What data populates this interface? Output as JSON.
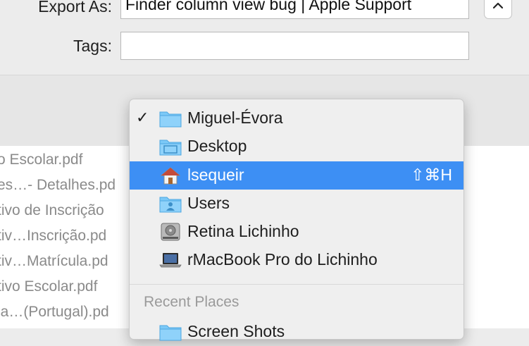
{
  "export": {
    "label": "Export As:",
    "value": "Finder column view bug | Apple Support"
  },
  "tags": {
    "label": "Tags:",
    "value": ""
  },
  "expand_button": {
    "icon": "chevron-up-icon"
  },
  "files": [
    "o Escolar.pdf",
    "es…- Detalhes.pd",
    "tivo de Inscrição",
    "tiv…Inscrição.pd",
    "tiv…Matrícula.pd",
    "tivo Escolar.pdf",
    "la…(Portugal).pd"
  ],
  "location_menu": {
    "items": [
      {
        "label": "Miguel-Évora",
        "icon": "folder-icon",
        "checked": true
      },
      {
        "label": "Desktop",
        "icon": "desktop-folder-icon"
      },
      {
        "label": "lsequeir",
        "icon": "home-icon",
        "selected": true,
        "shortcut": "⇧⌘H"
      },
      {
        "label": "Users",
        "icon": "users-folder-icon"
      },
      {
        "label": "Retina Lichinho",
        "icon": "hard-drive-icon"
      },
      {
        "label": "rMacBook Pro do Lichinho",
        "icon": "laptop-icon"
      }
    ],
    "check_glyph": "✓",
    "recent_header": "Recent Places",
    "recent_items": [
      {
        "label": "Screen Shots",
        "icon": "folder-icon"
      }
    ]
  },
  "colors": {
    "selection": "#3d8ff4",
    "folder": "#6ec3f5"
  }
}
